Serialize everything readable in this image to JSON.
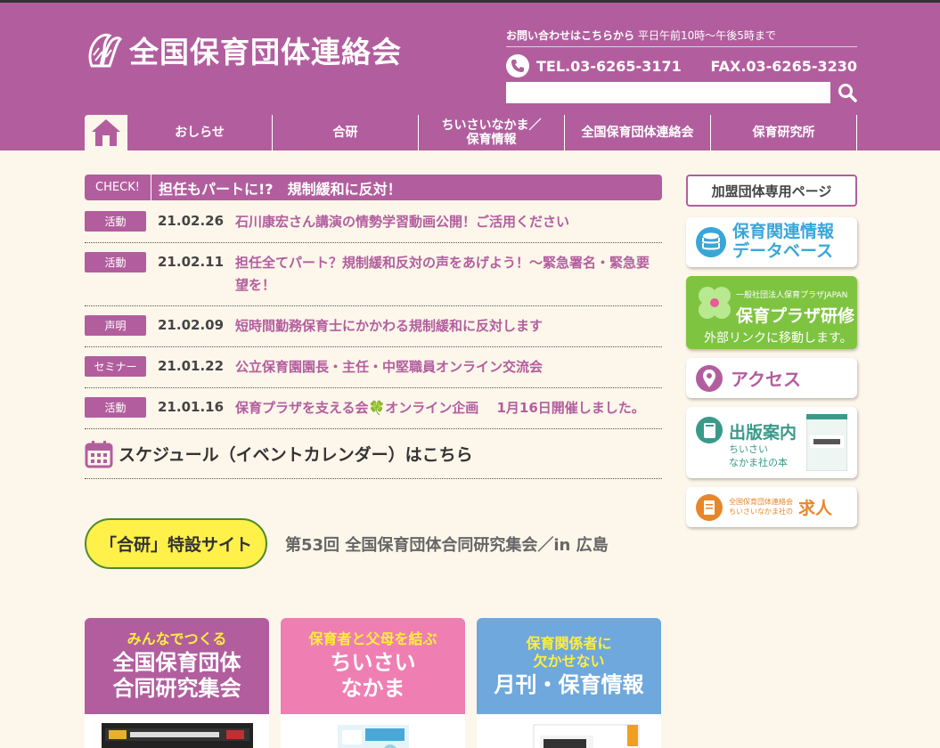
{
  "header": {
    "logo_text": "全国保育団体連絡会",
    "contact_label": "お問い合わせはこちらから",
    "contact_hours": "平日午前10時～午後5時まで",
    "tel": "TEL.03-6265-3171",
    "fax": "FAX.03-6265-3230",
    "search_placeholder": "",
    "colors": {
      "brand": "#b25e9e",
      "background": "#fdf6ea"
    }
  },
  "nav": {
    "items": [
      {
        "label": "おしらせ"
      },
      {
        "label": "合研"
      },
      {
        "label": "ちいさいなかま／\n保育情報"
      },
      {
        "label": "全国保育団体連絡会"
      },
      {
        "label": "保育研究所"
      }
    ]
  },
  "check": {
    "tag": "CHECK!",
    "text": "担任もパートに!?　規制緩和に反対！"
  },
  "news": [
    {
      "tag": "活動",
      "date": "21.02.26",
      "title": "石川康宏さん講演の情勢学習動画公開！ご活用ください"
    },
    {
      "tag": "活動",
      "date": "21.02.11",
      "title": "担任全てパート？規制緩和反対の声をあげよう！～緊急署名・緊急要望を！"
    },
    {
      "tag": "声明",
      "date": "21.02.09",
      "title": "短時間勤務保育士にかかわる規制緩和に反対します"
    },
    {
      "tag": "セミナー",
      "date": "21.01.22",
      "title": "公立保育園園長・主任・中堅職員オンライン交流会"
    },
    {
      "tag": "活動",
      "date": "21.01.16",
      "title": "保育プラザを支える会🍀オンライン企画　 1月16日開催しました。"
    }
  ],
  "schedule": {
    "label": "スケジュール（イベントカレンダー）はこちら"
  },
  "goken": {
    "button": "「合研」特設サイト",
    "text": "第53回 全国保育団体合同研究集会／in 広島"
  },
  "cards": [
    {
      "sub": "みんなでつくる",
      "title": "全国保育団体\n合同研究集会",
      "color": "#b25e9e"
    },
    {
      "sub": "保育者と父母を結ぶ",
      "title": "ちいさい\nなかま",
      "color": "#ef7fb2"
    },
    {
      "sub": "保育関係者に\n欠かせない",
      "title": "月刊・保育情報",
      "color": "#6fa8dc"
    }
  ],
  "sidebar": {
    "member": "加盟団体専用ページ",
    "db": "保育関連情報\nデータベース",
    "plaza_small": "一般社団法人保育プラザJAPAN",
    "plaza_big": "保育プラザ研修",
    "plaza_note": "外部リンクに移動します。",
    "access": "アクセス",
    "pub_title": "出版案内",
    "pub_sub": "ちいさい\nなかま社の本",
    "job_small": "全国保育団体連絡会\nちいさいなかま社の",
    "job_big": "求人"
  }
}
